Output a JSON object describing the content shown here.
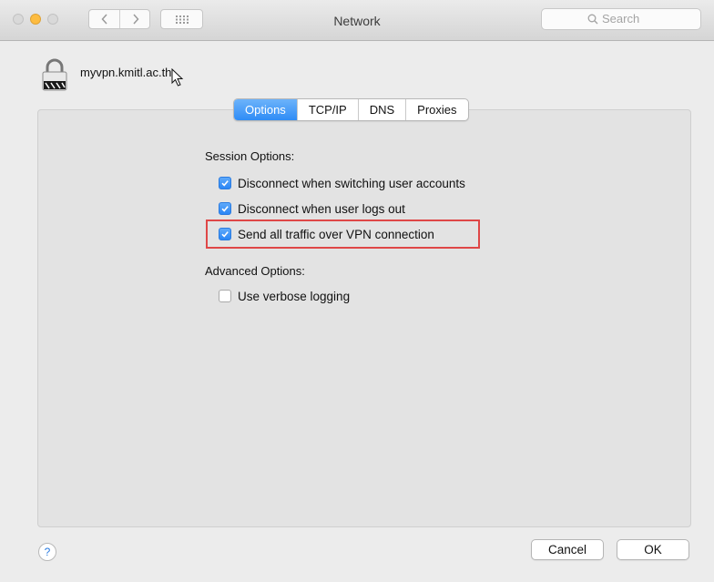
{
  "window": {
    "title": "Network"
  },
  "search": {
    "placeholder": "Search"
  },
  "vpn": {
    "name": "myvpn.kmitl.ac.th"
  },
  "tabs": [
    {
      "label": "Options",
      "active": true
    },
    {
      "label": "TCP/IP",
      "active": false
    },
    {
      "label": "DNS",
      "active": false
    },
    {
      "label": "Proxies",
      "active": false
    }
  ],
  "session": {
    "heading": "Session Options:",
    "options": [
      {
        "label": "Disconnect when switching user accounts",
        "checked": true
      },
      {
        "label": "Disconnect when user logs out",
        "checked": true
      },
      {
        "label": "Send all traffic over VPN connection",
        "checked": true
      }
    ]
  },
  "advanced": {
    "heading": "Advanced Options:",
    "options": [
      {
        "label": "Use verbose logging",
        "checked": false
      }
    ]
  },
  "buttons": {
    "help": "?",
    "cancel": "Cancel",
    "ok": "OK"
  },
  "colors": {
    "accent": "#2f8cf6",
    "highlight": "#df4747"
  }
}
